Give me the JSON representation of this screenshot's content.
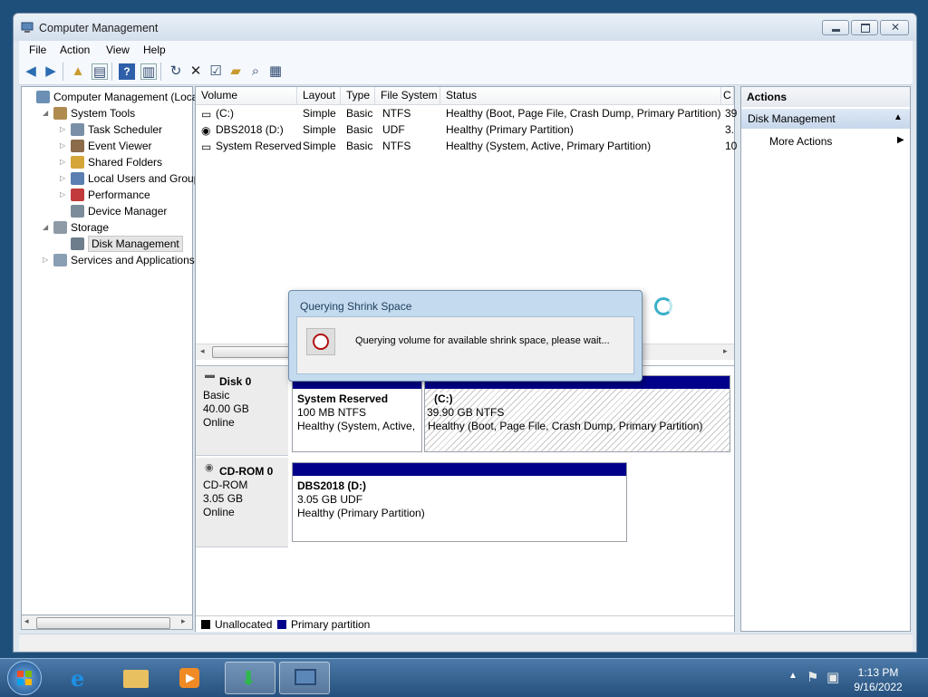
{
  "window": {
    "title": "Computer Management",
    "menu": [
      "File",
      "Action",
      "View",
      "Help"
    ]
  },
  "tree": {
    "items": [
      {
        "label": "Computer Management (Local",
        "level": 0,
        "twisty": ""
      },
      {
        "label": "System Tools",
        "level": 1,
        "twisty": "◢"
      },
      {
        "label": "Task Scheduler",
        "level": 2,
        "twisty": "▷"
      },
      {
        "label": "Event Viewer",
        "level": 2,
        "twisty": "▷"
      },
      {
        "label": "Shared Folders",
        "level": 2,
        "twisty": "▷"
      },
      {
        "label": "Local Users and Groups",
        "level": 2,
        "twisty": "▷"
      },
      {
        "label": "Performance",
        "level": 2,
        "twisty": "▷"
      },
      {
        "label": "Device Manager",
        "level": 2,
        "twisty": ""
      },
      {
        "label": "Storage",
        "level": 1,
        "twisty": "◢"
      },
      {
        "label": "Disk Management",
        "level": 2,
        "twisty": "",
        "selected": true
      },
      {
        "label": "Services and Applications",
        "level": 1,
        "twisty": "▷"
      }
    ]
  },
  "volumes": {
    "columns": [
      "Volume",
      "Layout",
      "Type",
      "File System",
      "Status",
      "C"
    ],
    "rows": [
      {
        "volume": "(C:)",
        "layout": "Simple",
        "type": "Basic",
        "fs": "NTFS",
        "status": "Healthy (Boot, Page File, Crash Dump, Primary Partition)",
        "cap": "39"
      },
      {
        "volume": "DBS2018 (D:)",
        "layout": "Simple",
        "type": "Basic",
        "fs": "UDF",
        "status": "Healthy (Primary Partition)",
        "cap": "3."
      },
      {
        "volume": "System Reserved",
        "layout": "Simple",
        "type": "Basic",
        "fs": "NTFS",
        "status": "Healthy (System, Active, Primary Partition)",
        "cap": "10"
      }
    ]
  },
  "disks": [
    {
      "name": "Disk 0",
      "kind": "Basic",
      "size": "40.00 GB",
      "state": "Online",
      "partitions": [
        {
          "name": "System Reserved",
          "size": "100 MB NTFS",
          "status": "Healthy (System, Active,"
        },
        {
          "name": "(C:)",
          "size": "39.90 GB NTFS",
          "status": "Healthy (Boot, Page File, Crash Dump, Primary Partition)"
        }
      ]
    },
    {
      "name": "CD-ROM 0",
      "kind": "CD-ROM",
      "size": "3.05 GB",
      "state": "Online",
      "partitions": [
        {
          "name": "DBS2018  (D:)",
          "size": "3.05 GB UDF",
          "status": "Healthy (Primary Partition)"
        }
      ]
    }
  ],
  "legend": {
    "unallocated": "Unallocated",
    "primary": "Primary partition"
  },
  "actions": {
    "header": "Actions",
    "section": "Disk Management",
    "more": "More Actions"
  },
  "dialog": {
    "title": "Querying Shrink Space",
    "message": "Querying volume for available shrink space, please wait..."
  },
  "taskbar": {
    "time": "1:13 PM",
    "date": "9/16/2022"
  },
  "colors": {
    "primary_partition": "#00008b",
    "unallocated": "#000000",
    "taskbar": "#2e5c8c"
  }
}
